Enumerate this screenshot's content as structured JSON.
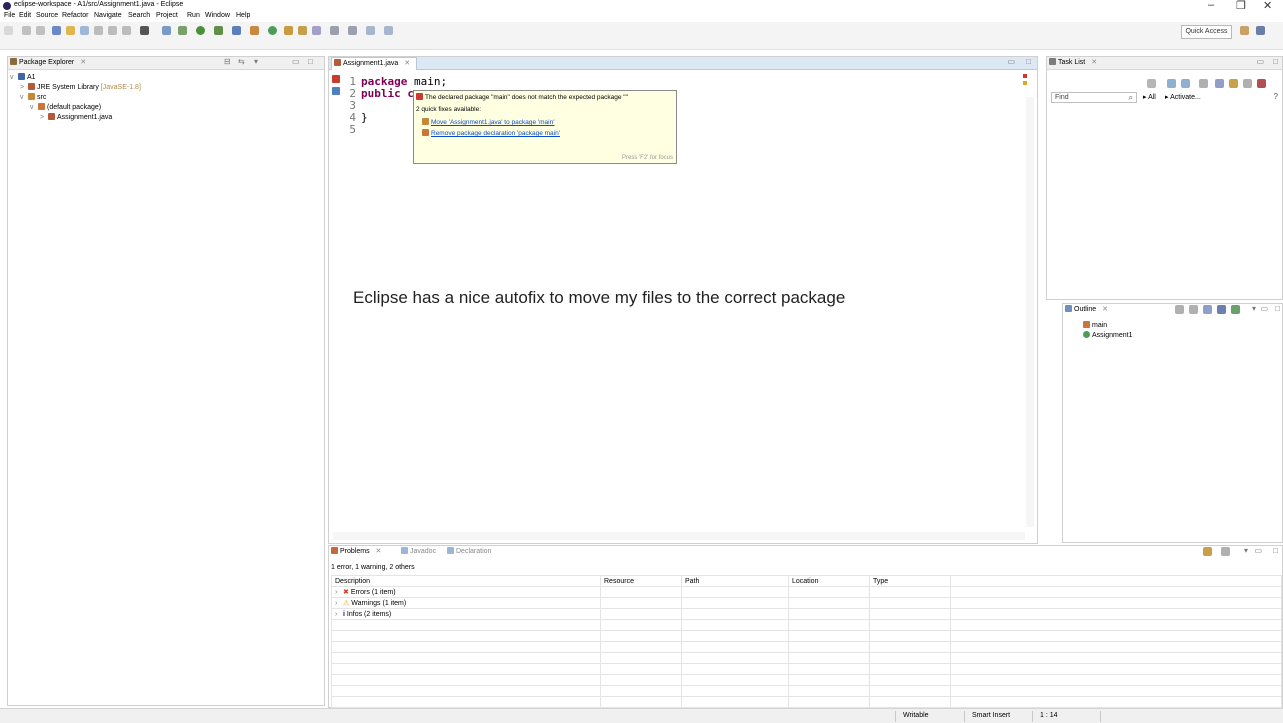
{
  "window": {
    "title": "eclipse-workspace - A1/src/Assignment1.java - Eclipse",
    "minimize_glyph": "–",
    "restore_glyph": "❐",
    "close_glyph": "✕"
  },
  "menubar": [
    "File",
    "Edit",
    "Source",
    "Refactor",
    "Navigate",
    "Search",
    "Project",
    "Run",
    "Window",
    "Help"
  ],
  "toolbar": {
    "quick_access": "Quick Access"
  },
  "package_explorer": {
    "title": "Package Explorer",
    "close_glyph": "✕",
    "tree": [
      {
        "label": "A1",
        "icon": "project-icon",
        "chevron": "v"
      },
      {
        "label": "JRE System Library",
        "suffix": "[JavaSE-1.8]",
        "icon": "library-icon",
        "chevron": ">"
      },
      {
        "label": "src",
        "icon": "source-folder-icon",
        "chevron": "v"
      },
      {
        "label": "(default package)",
        "icon": "package-icon",
        "chevron": "v"
      },
      {
        "label": "Assignment1.java",
        "icon": "java-file-icon",
        "chevron": ">"
      }
    ]
  },
  "editor": {
    "tab_label": "Assignment1.java",
    "close_glyph": "✕",
    "lines": [
      {
        "num": "1",
        "kw": "package",
        "rest": " main;"
      },
      {
        "num": "2",
        "kw": "public",
        "rest": " c"
      },
      {
        "num": "3",
        "kw": "",
        "rest": ""
      },
      {
        "num": "4",
        "kw": "",
        "rest": "}"
      },
      {
        "num": "5",
        "kw": "",
        "rest": ""
      }
    ]
  },
  "quickfix": {
    "message": "The declared package \"main\" does not match the expected package \"\"",
    "count": "2 quick fixes available:",
    "fixes": [
      "Move 'Assignment1.java' to package 'main'",
      "Remove package declaration 'package main'"
    ],
    "hint": "Press 'F2' for focus"
  },
  "task_list": {
    "title": "Task List",
    "close_glyph": "✕",
    "find_placeholder": "Find",
    "all_label": "All",
    "activate_label": "Activate...",
    "triangle_glyph": "▸",
    "help_glyph": "?"
  },
  "outline": {
    "title": "Outline",
    "close_glyph": "✕",
    "items": [
      "main",
      "Assignment1"
    ]
  },
  "problems": {
    "tabs": [
      "Problems",
      "Javadoc",
      "Declaration"
    ],
    "close_glyph": "✕",
    "summary": "1 error, 1 warning, 2 others",
    "columns": [
      "Description",
      "Resource",
      "Path",
      "Location",
      "Type"
    ],
    "rows": [
      {
        "label": "Errors (1 item)",
        "icon": "error-icon",
        "glyph": "✖",
        "color": "#d9342b"
      },
      {
        "label": "Warnings (1 item)",
        "icon": "warning-icon",
        "glyph": "⚠",
        "color": "#e0a526"
      },
      {
        "label": "Infos (2 items)",
        "icon": "info-icon",
        "glyph": "i",
        "color": "#1a1a8a"
      }
    ]
  },
  "annotation": "Eclipse has a nice autofix to move my files to the correct package",
  "statusbar": {
    "writable": "Writable",
    "insert_mode": "Smart Insert",
    "position": "1 : 14"
  },
  "colors": {
    "keyword": "#7f0055",
    "link": "#0b4cc9",
    "popup_bg": "#ffffe1"
  }
}
